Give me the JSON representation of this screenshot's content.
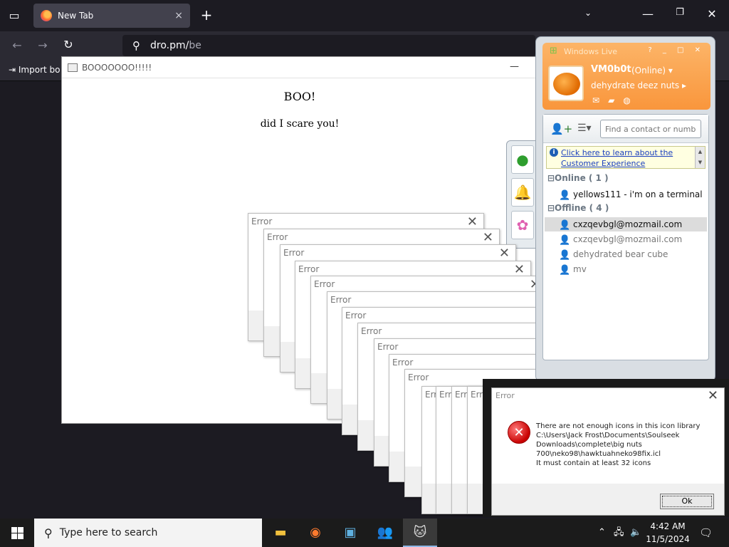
{
  "browser": {
    "tab_title": "New Tab",
    "tab_close": "×",
    "new_tab": "+",
    "url_host": "dro.pm/",
    "url_path": "be",
    "bookmark_label": "Import bo"
  },
  "boo_window": {
    "title": "BOOOOOOO!!!!!",
    "minimize": "—",
    "heading": "BOO!",
    "text": "did I scare you!"
  },
  "error_cascade": {
    "title": "Error",
    "close": "✕",
    "small_title": "Erro"
  },
  "error_dialog": {
    "title": "Error",
    "close": "✕",
    "icon": "✕",
    "message_lines": [
      "There are not enough icons in this icon library",
      "C:\\Users\\Jack Frost\\Documents\\Soulseek",
      "Downloads\\complete\\big nuts",
      "700\\neko98\\hawktuahneko98fix.icl",
      "It must contain at least 32 icons"
    ],
    "ok_label": "Ok"
  },
  "messenger": {
    "brand": "Windows Live",
    "window_controls": "? _ □ ✕",
    "username": "VM0b0t",
    "status": "(Online) ▾",
    "personal_message": "dehydrate deez nuts ▸",
    "search_placeholder": "Find a contact or number",
    "info_link": "Click here to learn about the Customer Experience",
    "scroll_up": "▲",
    "scroll_down": "▼",
    "groups": [
      {
        "label": "⊟Online ( 1 )"
      },
      {
        "label": "⊟Offline ( 4 )"
      }
    ],
    "online_contacts": [
      {
        "name": "yellows111 - i'm on a terminal"
      }
    ],
    "offline_contacts": [
      {
        "name": "cxzqevbgl@mozmail.com"
      },
      {
        "name": "cxzqevbgl@mozmail.com"
      },
      {
        "name": "dehydrated bear cube"
      },
      {
        "name": "mv"
      }
    ]
  },
  "taskbar": {
    "search_placeholder": "Type here to search",
    "time": "4:42 AM",
    "date": "11/5/2024"
  }
}
